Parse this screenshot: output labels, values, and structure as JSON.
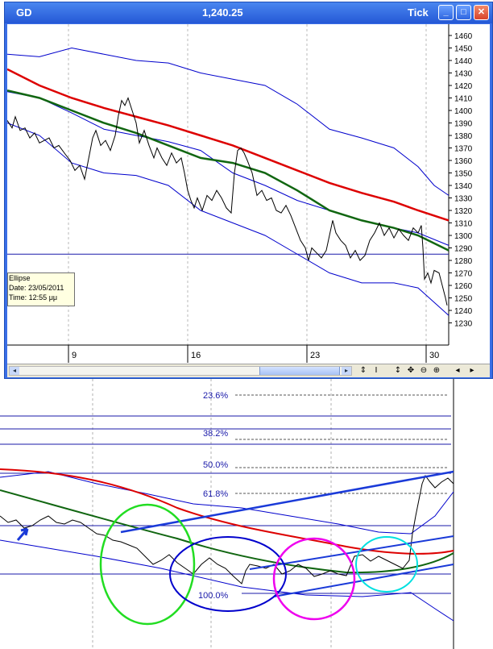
{
  "window": {
    "symbol": "GD",
    "last_price": "1,240.25",
    "mode": "Tick",
    "minimize_label": "_",
    "maximize_label": "□",
    "close_label": "✕"
  },
  "top_chart": {
    "price_axis": [
      "1460",
      "1450",
      "1440",
      "1430",
      "1420",
      "1410",
      "1400",
      "1390",
      "1380",
      "1370",
      "1360",
      "1350",
      "1340",
      "1330",
      "1320",
      "1310",
      "1300",
      "1290",
      "1280",
      "1270",
      "1260",
      "1250",
      "1240",
      "1230"
    ],
    "date_labels": [
      "9",
      "16",
      "23",
      "30"
    ]
  },
  "tooltip": {
    "title": "Ellipse",
    "date": "Date: 23/05/2011",
    "time": "Time: 12:55 μμ"
  },
  "toolbar": {
    "tools": [
      "⇕",
      "I",
      "↕",
      "✥",
      "⊖",
      "⊕",
      "◂",
      "▸"
    ]
  },
  "fib_levels": [
    "23.6%",
    "38.2%",
    "50.0%",
    "61.8%",
    "100.0%"
  ],
  "colors": {
    "window_blue": "#2458d6",
    "price_line": "#000000",
    "band_blue": "#0000cc",
    "ma_red": "#dd0000",
    "ma_green": "#116611",
    "circle_green": "#22dd22",
    "circle_blue": "#0000cc",
    "circle_magenta": "#ee00ee",
    "circle_cyan": "#00e0e0"
  }
}
